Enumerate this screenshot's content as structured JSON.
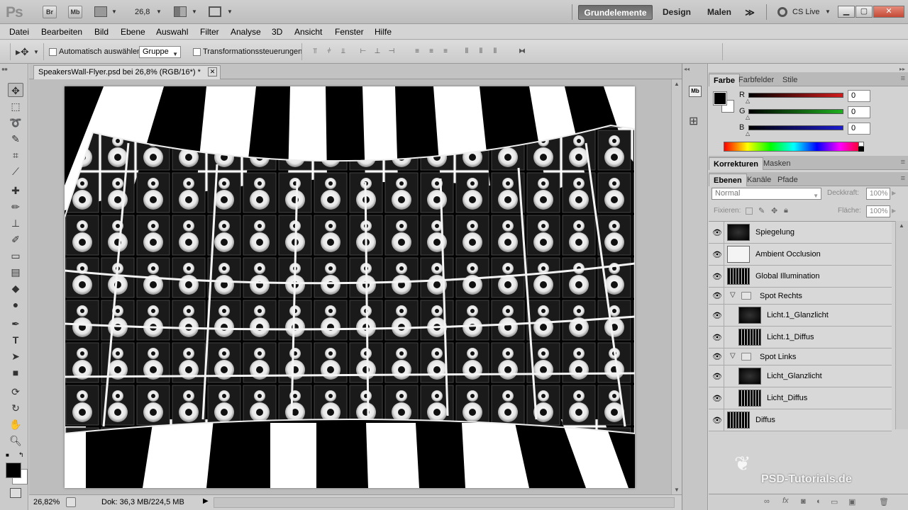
{
  "titlebar": {
    "app_logo": "Ps",
    "bridge_label": "Br",
    "minibridge_label": "Mb",
    "zoom_value": "26,8",
    "workspaces": [
      "Grundelemente",
      "Design",
      "Malen"
    ],
    "more_label": "≫",
    "cslive_label": "CS Live",
    "window_buttons": [
      "▁",
      "▢",
      "✕"
    ]
  },
  "menu": [
    "Datei",
    "Bearbeiten",
    "Bild",
    "Ebene",
    "Auswahl",
    "Filter",
    "Analyse",
    "3D",
    "Ansicht",
    "Fenster",
    "Hilfe"
  ],
  "options": {
    "auto_select_label": "Automatisch auswählen:",
    "auto_select_value": "Gruppe",
    "transform_label": "Transformationssteuerungen"
  },
  "document": {
    "tab_title": "SpeakersWall-Flyer.psd bei 26,8% (RGB/16*) *",
    "tab_close": "✕",
    "status_zoom": "26,82%",
    "status_doc": "Dok: 36,3 MB/224,5 MB"
  },
  "color_panel": {
    "tabs": [
      "Farbe",
      "Farbfelder",
      "Stile"
    ],
    "channels": [
      {
        "label": "R",
        "value": "0",
        "color": "#d11c1c"
      },
      {
        "label": "G",
        "value": "0",
        "color": "#1fb01f"
      },
      {
        "label": "B",
        "value": "0",
        "color": "#1c1ccf"
      }
    ]
  },
  "adjust_panel": {
    "tabs": [
      "Korrekturen",
      "Masken"
    ]
  },
  "layers_panel": {
    "tabs": [
      "Ebenen",
      "Kanäle",
      "Pfade"
    ],
    "blend_mode": "Normal",
    "opacity_label": "Deckkraft:",
    "opacity_value": "100%",
    "lock_label": "Fixieren:",
    "fill_label": "Fläche:",
    "fill_value": "100%",
    "layers": [
      {
        "name": "Spiegelung",
        "type": "layer",
        "indent": 0,
        "thumb": "dark"
      },
      {
        "name": "Ambient Occlusion",
        "type": "layer",
        "indent": 0,
        "thumb": "light"
      },
      {
        "name": "Global Illumination",
        "type": "layer",
        "indent": 0,
        "thumb": "speckle"
      },
      {
        "name": "Spot Rechts",
        "type": "group",
        "indent": 0
      },
      {
        "name": "Licht.1_Glanzlicht",
        "type": "layer",
        "indent": 1,
        "thumb": "dark"
      },
      {
        "name": "Licht.1_Diffus",
        "type": "layer",
        "indent": 1,
        "thumb": "speckle"
      },
      {
        "name": "Spot Links",
        "type": "group",
        "indent": 0
      },
      {
        "name": "Licht_Glanzlicht",
        "type": "layer",
        "indent": 1,
        "thumb": "dark"
      },
      {
        "name": "Licht_Diffus",
        "type": "layer",
        "indent": 1,
        "thumb": "speckle"
      },
      {
        "name": "Diffus",
        "type": "layer",
        "indent": 0,
        "thumb": "speckle"
      }
    ]
  },
  "watermark": "PSD-Tutorials.de"
}
